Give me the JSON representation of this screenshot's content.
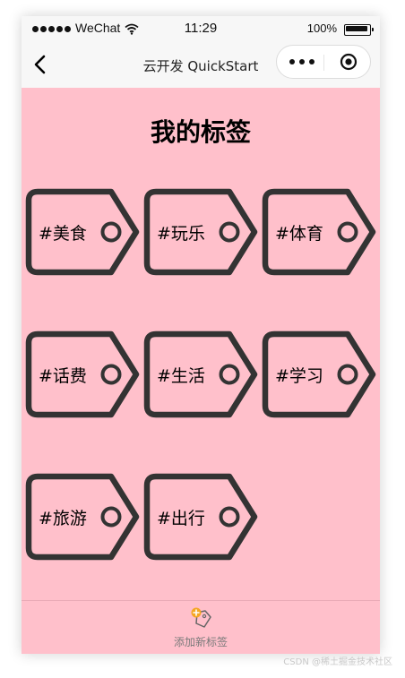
{
  "status_bar": {
    "carrier": "WeChat",
    "time": "11:29",
    "battery": "100%"
  },
  "nav": {
    "title": "云开发 QuickStart",
    "back_icon": "chevron-left-icon",
    "more_icon": "more-dots-icon",
    "close_icon": "target-close-icon"
  },
  "page": {
    "title": "我的标签"
  },
  "tags": [
    {
      "label": "#美食"
    },
    {
      "label": "#玩乐"
    },
    {
      "label": "#体育"
    },
    {
      "label": "#话费"
    },
    {
      "label": "#生活"
    },
    {
      "label": "#学习"
    },
    {
      "label": "#旅游"
    },
    {
      "label": "#出行"
    }
  ],
  "tab_bar": {
    "add_label": "添加新标签",
    "add_icon": "add-tag-icon"
  },
  "watermark": "CSDN @稀土掘金技术社区",
  "colors": {
    "background": "#ffc0cb",
    "tag_outline": "#333333",
    "bar": "#f7f7f7",
    "accent": "#f5a623"
  }
}
